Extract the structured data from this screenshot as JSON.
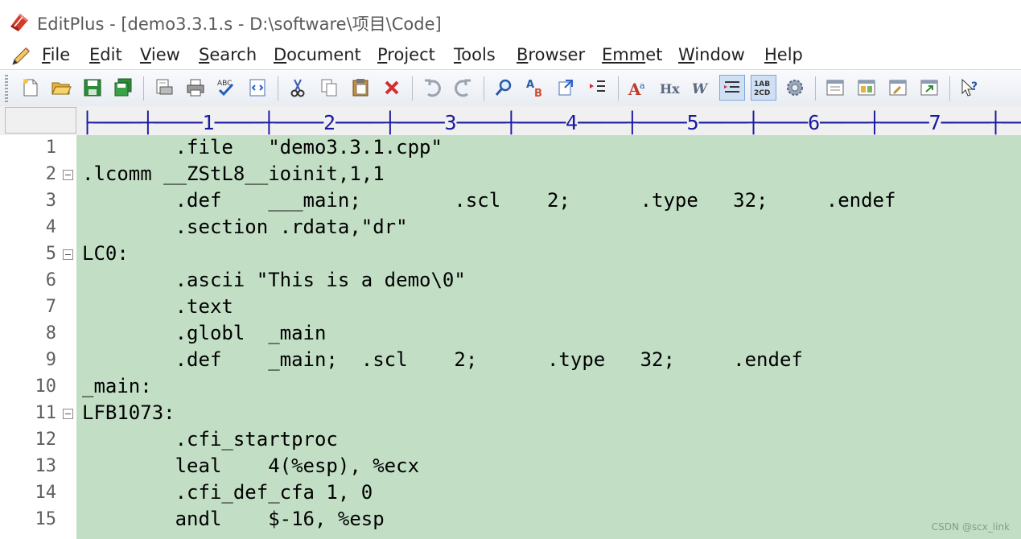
{
  "window": {
    "title": "EditPlus - [demo3.3.1.s - D:\\software\\项目\\Code]"
  },
  "menu": {
    "items": [
      {
        "label_mnemonic": "F",
        "label_rest": "ile"
      },
      {
        "label_mnemonic": "E",
        "label_rest": "dit"
      },
      {
        "label_mnemonic": "V",
        "label_rest": "iew"
      },
      {
        "label_mnemonic": "S",
        "label_rest": "earch"
      },
      {
        "label_mnemonic": "D",
        "label_rest": "ocument"
      },
      {
        "label_mnemonic": "P",
        "label_rest": "roject"
      },
      {
        "label_mnemonic": "T",
        "label_rest": "ools"
      },
      {
        "label_mnemonic": "B",
        "label_rest": "rowser"
      },
      {
        "label_mnemonic": "Emm",
        "label_rest": "et"
      },
      {
        "label_mnemonic": "W",
        "label_rest": "indow"
      },
      {
        "label_mnemonic": "H",
        "label_rest": "elp"
      }
    ]
  },
  "toolbar": {
    "buttons": [
      "new-file-icon",
      "open-folder-icon",
      "save-icon",
      "save-all-icon",
      "print-preview-icon",
      "print-icon",
      "spell-check-icon",
      "browser-preview-icon",
      "cut-icon",
      "copy-icon",
      "paste-icon",
      "delete-icon",
      "undo-icon",
      "redo-icon",
      "find-icon",
      "replace-icon",
      "goto-icon",
      "indent-icon",
      "font-icon",
      "hex-icon",
      "word-wrap-icon",
      "line-numbers-icon",
      "column-ruler-icon",
      "settings-icon",
      "cliptext-icon",
      "directory-icon",
      "output-icon",
      "fullscreen-icon",
      "help-icon"
    ],
    "colors": {
      "accent": "#c2dfc5",
      "ruler_text": "#1a1aa0"
    }
  },
  "ruler": {
    "text": "├────┼────1────┼────2────┼────3────┼────4────┼────5────┼────6────┼────7────┼────"
  },
  "editor": {
    "lines": [
      {
        "num": "1",
        "fold": false,
        "text": "        .file   \"demo3.3.1.cpp\""
      },
      {
        "num": "2",
        "fold": true,
        "text": ".lcomm __ZStL8__ioinit,1,1"
      },
      {
        "num": "3",
        "fold": false,
        "text": "        .def    ___main;        .scl    2;      .type   32;     .endef"
      },
      {
        "num": "4",
        "fold": false,
        "text": "        .section .rdata,\"dr\""
      },
      {
        "num": "5",
        "fold": true,
        "text": "LC0:"
      },
      {
        "num": "6",
        "fold": false,
        "text": "        .ascii \"This is a demo\\0\""
      },
      {
        "num": "7",
        "fold": false,
        "text": "        .text"
      },
      {
        "num": "8",
        "fold": false,
        "text": "        .globl  _main"
      },
      {
        "num": "9",
        "fold": false,
        "text": "        .def    _main;  .scl    2;      .type   32;     .endef"
      },
      {
        "num": "10",
        "fold": false,
        "text": "_main:"
      },
      {
        "num": "11",
        "fold": true,
        "text": "LFB1073:"
      },
      {
        "num": "12",
        "fold": false,
        "text": "        .cfi_startproc"
      },
      {
        "num": "13",
        "fold": false,
        "text": "        leal    4(%esp), %ecx"
      },
      {
        "num": "14",
        "fold": false,
        "text": "        .cfi_def_cfa 1, 0"
      },
      {
        "num": "15",
        "fold": false,
        "text": "        andl    $-16, %esp"
      }
    ]
  },
  "watermark": "CSDN @scx_link"
}
